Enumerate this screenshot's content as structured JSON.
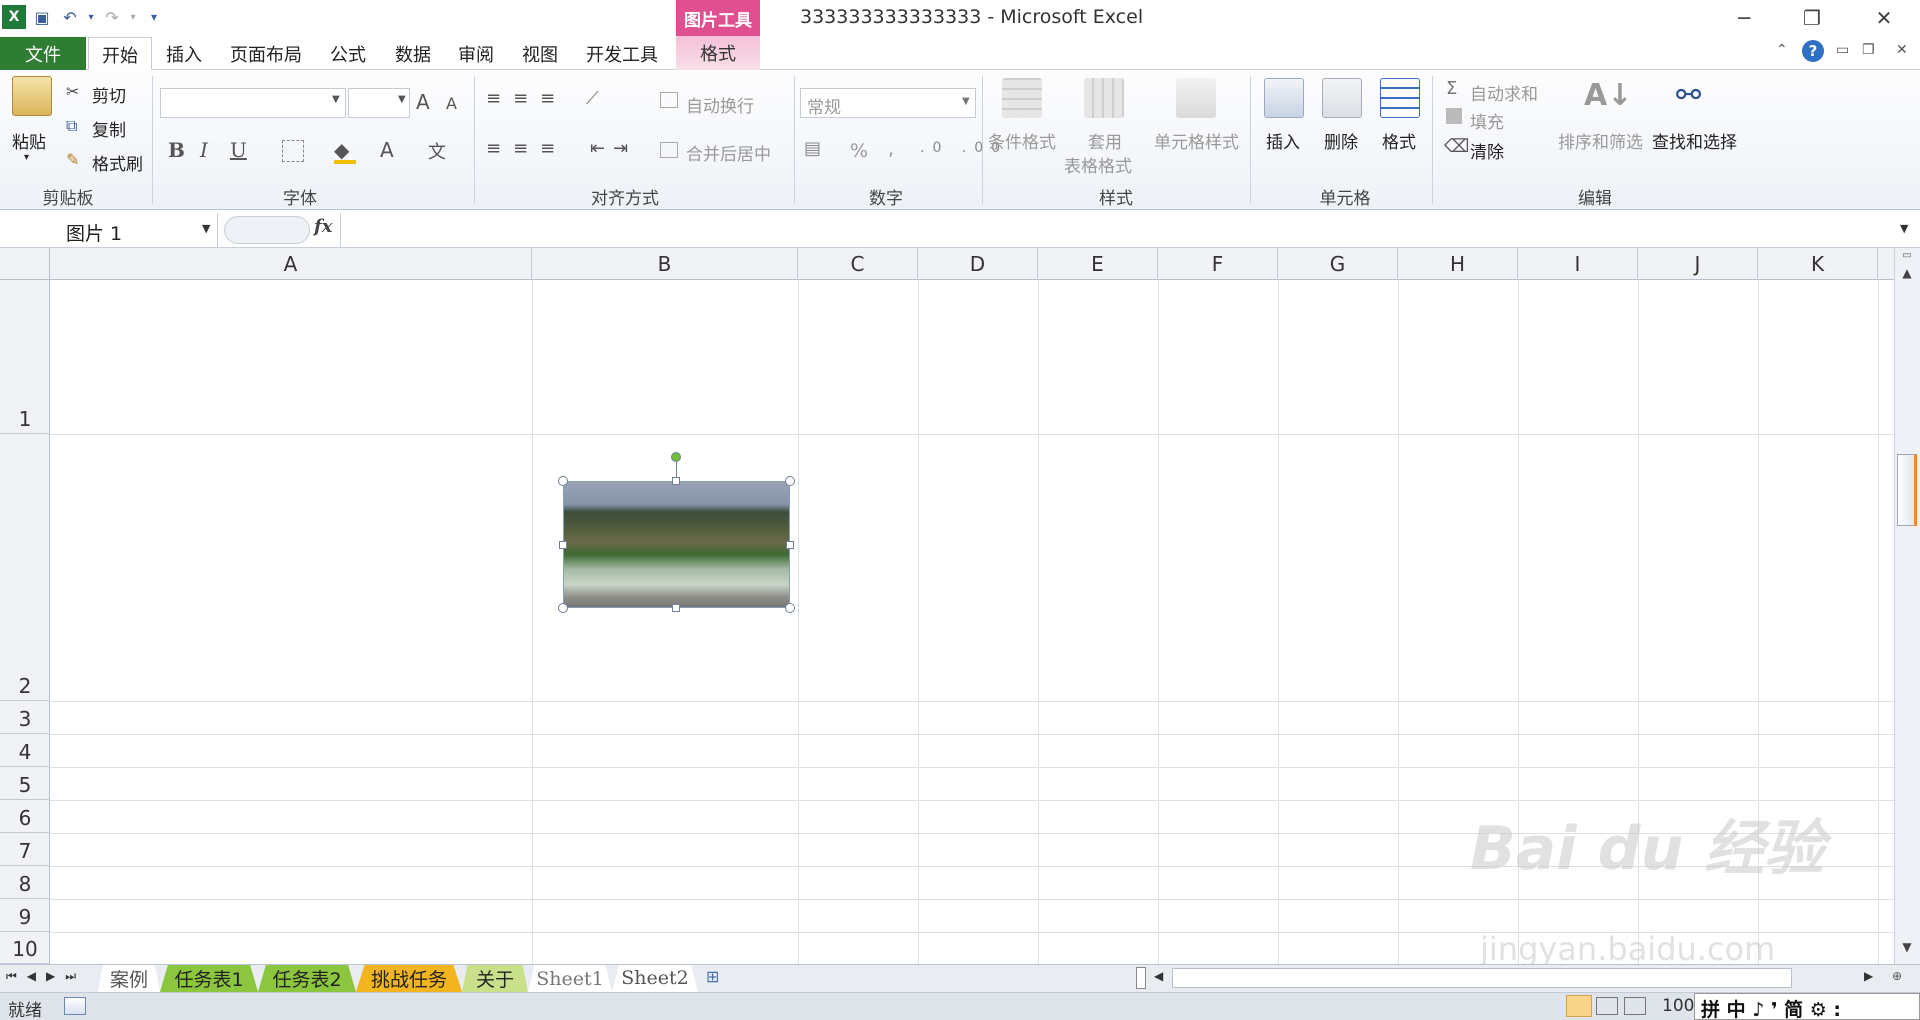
{
  "window": {
    "title": "333333333333333 - Microsoft Excel",
    "minimize_glyph": "─",
    "restore_glyph": "❐",
    "close_glyph": "✕"
  },
  "context_tab": {
    "group": "图片工具",
    "tab": "格式"
  },
  "tabs": {
    "file": "文件",
    "items": [
      "开始",
      "插入",
      "页面布局",
      "公式",
      "数据",
      "审阅",
      "视图",
      "开发工具"
    ],
    "active": "开始"
  },
  "ribbon": {
    "clipboard": {
      "label": "剪贴板",
      "paste": "粘贴",
      "cut": "剪切",
      "copy": "复制",
      "format_painter": "格式刷"
    },
    "font": {
      "label": "字体",
      "bold": "B",
      "italic": "I",
      "underline": "U",
      "grow": "A",
      "shrink": "A"
    },
    "alignment": {
      "label": "对齐方式",
      "wrap_text": "自动换行",
      "merge_center": "合并后居中"
    },
    "number": {
      "label": "数字",
      "format": "常规",
      "percent": "%",
      "comma": ","
    },
    "styles": {
      "label": "样式",
      "conditional": "条件格式",
      "table_format_1": "套用",
      "table_format_2": "表格格式",
      "cell_styles": "单元格样式"
    },
    "cells": {
      "label": "单元格",
      "insert": "插入",
      "delete": "删除",
      "format": "格式"
    },
    "editing": {
      "label": "编辑",
      "autosum": "自动求和",
      "fill": "填充",
      "clear": "清除",
      "sort_filter": "排序和筛选",
      "find_select": "查找和选择"
    }
  },
  "formula_bar": {
    "name_box": "图片 1",
    "fx": "fx",
    "content": ""
  },
  "grid": {
    "columns": [
      "A",
      "B",
      "C",
      "D",
      "E",
      "F",
      "G",
      "H",
      "I",
      "J",
      "K"
    ],
    "rows": [
      "1",
      "2",
      "3",
      "4",
      "5",
      "6",
      "7",
      "8",
      "9",
      "10"
    ]
  },
  "sheets": {
    "tabs": [
      "案例",
      "任务表1",
      "任务表2",
      "挑战任务",
      "关于",
      "Sheet1",
      "Sheet2"
    ],
    "active": "Sheet2"
  },
  "status": {
    "ready": "就绪",
    "zoom": "100",
    "ime": "拼 中 ♪ ❜ 简 ⚙ :"
  },
  "watermark": {
    "brand": "Bai du 经验",
    "url": "jingyan.baidu.com"
  },
  "colors": {
    "file_tab": "#2e7d32",
    "context_group": "#e04f8f",
    "selection_handle": "#6fbf3a"
  },
  "icons": [
    "excel-icon",
    "save-icon",
    "undo-icon",
    "redo-icon",
    "help-icon",
    "paste-icon",
    "scissors-icon",
    "copy-icon",
    "brush-icon",
    "sigma-icon",
    "binoculars-icon",
    "sort-icon"
  ]
}
